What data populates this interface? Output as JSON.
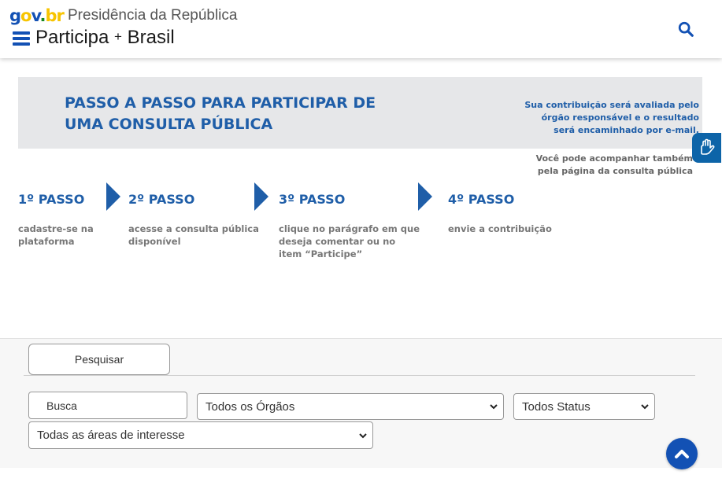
{
  "header": {
    "logo": {
      "g": "g",
      "o": "o",
      "v": "v",
      "dot": ".",
      "br": "br"
    },
    "org_name": "Presidência da República",
    "site_title_a": "Participa",
    "site_title_plus": "+",
    "site_title_b": "Brasil"
  },
  "banner": {
    "title_line1": "PASSO A PASSO PARA PARTICIPAR DE",
    "title_line2": "UMA CONSULTA PÚBLICA",
    "note_line1": "Sua contribuição será avaliada pelo",
    "note_line2": "órgão responsável e o resultado",
    "note_line3": "será encaminhado por e-mail.",
    "note2_line1": "Você pode acompanhar também",
    "note2_line2": "pela página da consulta pública",
    "steps": [
      {
        "title": "1º PASSO",
        "desc_line1": "cadastre-se na",
        "desc_line2": "plataforma",
        "desc_line3": ""
      },
      {
        "title": "2º PASSO",
        "desc_line1": "acesse a consulta pública",
        "desc_line2": "disponível",
        "desc_line3": ""
      },
      {
        "title": "3º PASSO",
        "desc_line1": "clique no parágrafo em que",
        "desc_line2": "deseja comentar ou no",
        "desc_line3": "item “Participe”"
      },
      {
        "title": "4º PASSO",
        "desc_line1": "envie a contribuição",
        "desc_line2": "",
        "desc_line3": ""
      }
    ]
  },
  "filters": {
    "tab_label": "Pesquisar",
    "search_placeholder": "Busca",
    "orgaos_selected": "Todos os Órgãos",
    "status_selected": "Todos Status",
    "areas_selected": "Todas as áreas de interesse"
  },
  "colors": {
    "brand_blue": "#1351b4",
    "banner_blue": "#1f5ea8",
    "vlibras_blue": "#0d64a8"
  },
  "icons": {
    "search": "search-icon",
    "menu": "hamburger-menu-icon",
    "vlibras": "hand-sign-language-icon",
    "back_to_top": "chevron-up-icon"
  }
}
